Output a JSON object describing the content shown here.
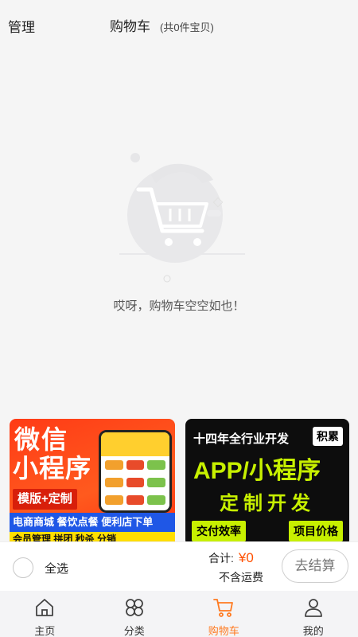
{
  "header": {
    "manage_label": "管理",
    "title": "购物车",
    "subtitle": "(共0件宝贝)"
  },
  "empty_state": {
    "message": "哎呀，购物车空空如也！"
  },
  "ads": {
    "left": {
      "line1": "微信",
      "line2": "小程序",
      "badge": "模版+定制",
      "strip": "电商商城  餐饮点餐  便利店下单",
      "bottom": "会员管理  拼团  秒杀  分销"
    },
    "right": {
      "headline": "十四年全行业开发",
      "tag": "积累",
      "big": "APP/小程序",
      "mid": "定制开发",
      "btn1": "交付效率",
      "btn2": "项目价格"
    }
  },
  "checkout": {
    "select_all_label": "全选",
    "total_label": "合计:",
    "total_value": "¥0",
    "shipping_note": "不含运费",
    "checkout_button": "去结算"
  },
  "tabbar": {
    "items": [
      {
        "label": "主页",
        "icon": "home-icon"
      },
      {
        "label": "分类",
        "icon": "category-icon"
      },
      {
        "label": "购物车",
        "icon": "cart-icon"
      },
      {
        "label": "我的",
        "icon": "profile-icon"
      }
    ],
    "active_index": 2
  },
  "colors": {
    "accent": "#ff7a20",
    "price": "#ff5000",
    "background": "#f5f5f5"
  }
}
